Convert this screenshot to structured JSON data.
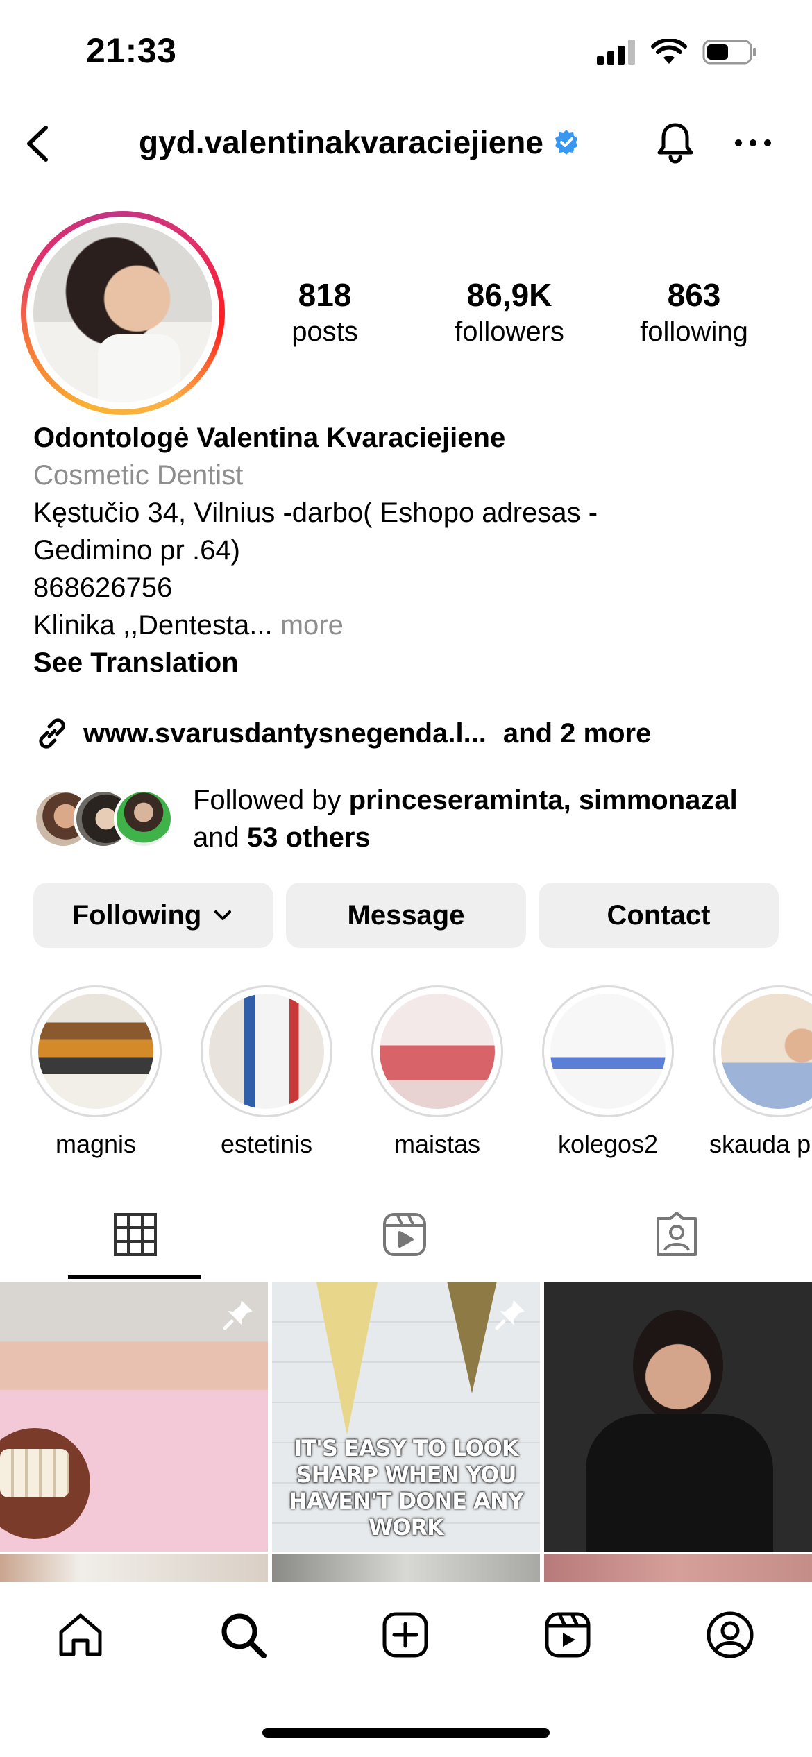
{
  "status_bar": {
    "time": "21:33"
  },
  "header": {
    "username": "gyd.valentinakvaraciejiene"
  },
  "stats": [
    {
      "value": "818",
      "label": "posts"
    },
    {
      "value": "86,9K",
      "label": "followers"
    },
    {
      "value": "863",
      "label": "following"
    }
  ],
  "bio": {
    "name": "Odontologė Valentina Kvaraciejiene",
    "category": "Cosmetic Dentist",
    "line1": "Kęstučio 34, Vilnius -darbo( Eshopo adresas -",
    "line2": "Gedimino pr .64)",
    "phone": "868626756",
    "line4": "Klinika ,,Dentesta...",
    "more": " more",
    "translate": "See Translation"
  },
  "link": {
    "url": "www.svarusdantysnegenda.l...",
    "extra": "and 2 more"
  },
  "followed_by": {
    "prefix": "Followed by ",
    "users": "princeseraminta, simmonazal",
    "and": "and ",
    "others": "53 others"
  },
  "buttons": {
    "following": "Following",
    "message": "Message",
    "contact": "Contact"
  },
  "highlights": [
    {
      "label": "magnis"
    },
    {
      "label": "estetinis"
    },
    {
      "label": "maistas"
    },
    {
      "label": "kolegos2"
    },
    {
      "label": "skauda p"
    }
  ],
  "post_overlay_text": [
    "IT'S EASY TO LOOK",
    "SHARP WHEN YOU",
    "HAVEN'T DONE ANY WORK"
  ],
  "colors": {
    "verified": "#3897f0",
    "secondary_text": "#8e8e8e",
    "button_bg": "#efefef"
  }
}
